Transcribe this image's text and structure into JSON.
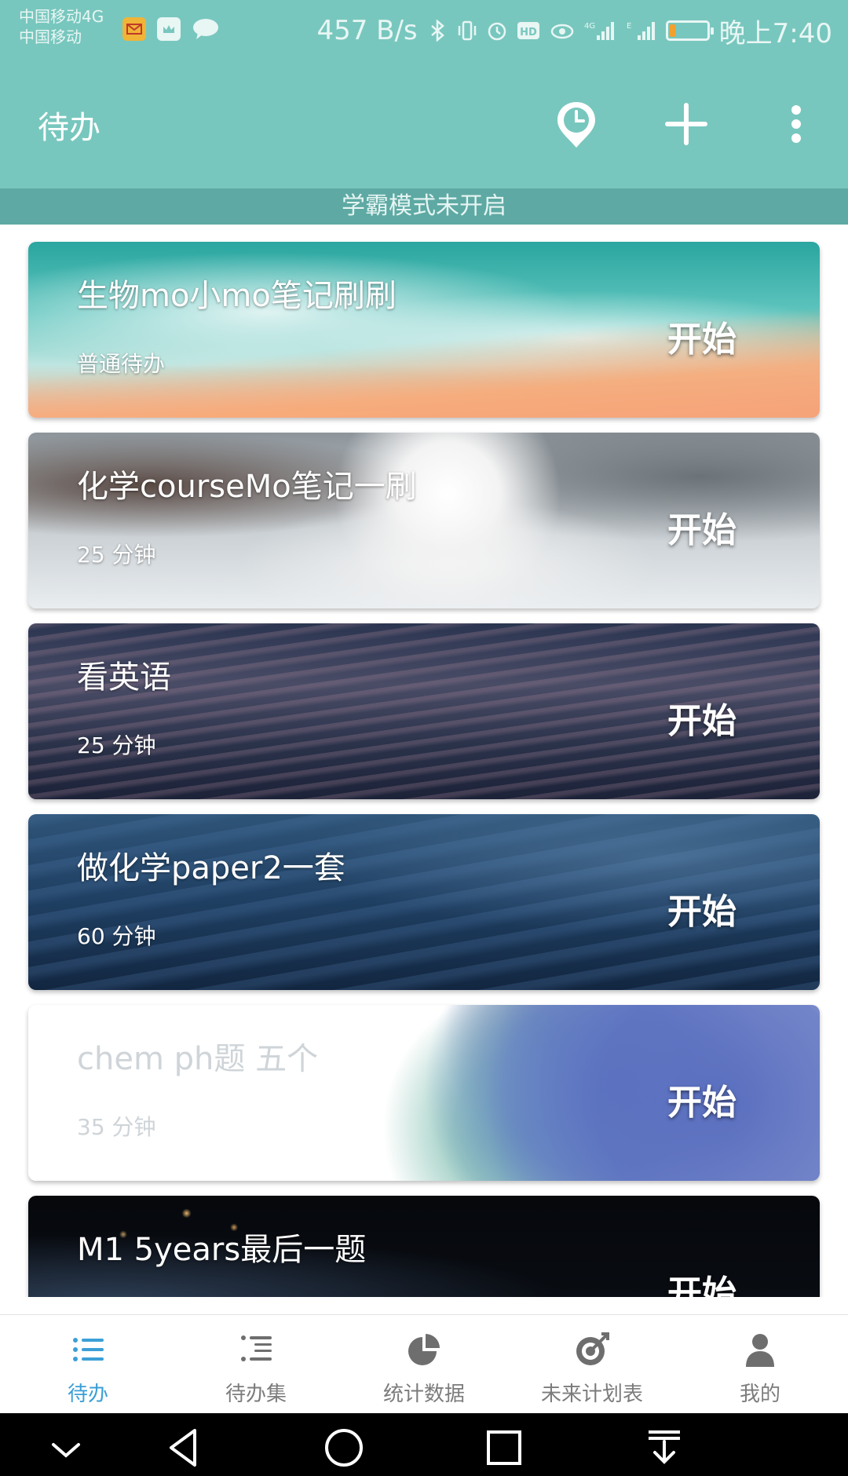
{
  "status_bar": {
    "carrier_line1": "中国移动4G",
    "carrier_line2": "中国移动",
    "net_speed": "457 B/s",
    "time": "晚上7:40",
    "battery_level": 0.15,
    "battery_color": "#f2a02f",
    "icons": [
      "mail-icon",
      "weibo-icon",
      "message-icon",
      "bluetooth-icon",
      "vibrate-icon",
      "alarm-icon",
      "hd-icon",
      "eye-icon",
      "signal-4g-icon",
      "signal-e-icon",
      "battery-icon"
    ]
  },
  "app_bar": {
    "title": "待办",
    "actions": [
      "clock-icon",
      "add-icon",
      "more-vert-icon"
    ],
    "color": "#78c7be"
  },
  "mode_banner": "学霸模式未开启",
  "todos": [
    {
      "title": "生物mo小mo笔记刷刷",
      "subtitle": "普通待办",
      "action": "开始",
      "background": "beach"
    },
    {
      "title": "化学courseMo笔记一刷",
      "subtitle": "25 分钟",
      "action": "开始",
      "background": "dog"
    },
    {
      "title": "看英语",
      "subtitle": "25 分钟",
      "action": "开始",
      "background": "dark-waves"
    },
    {
      "title": "做化学paper2一套",
      "subtitle": "60 分钟",
      "action": "开始",
      "background": "blue-waves"
    },
    {
      "title": "chem ph题 五个",
      "subtitle": "35 分钟",
      "action": "开始",
      "background": "watercolor"
    },
    {
      "title": "M1 5years最后一题",
      "subtitle": "",
      "action": "开始",
      "background": "space"
    }
  ],
  "bottom_nav": {
    "active_color": "#3b9fd6",
    "items": [
      {
        "label": "待办",
        "icon": "list-icon",
        "active": true
      },
      {
        "label": "待办集",
        "icon": "list-set-icon",
        "active": false
      },
      {
        "label": "统计数据",
        "icon": "pie-chart-icon",
        "active": false
      },
      {
        "label": "未来计划表",
        "icon": "target-icon",
        "active": false
      },
      {
        "label": "我的",
        "icon": "person-icon",
        "active": false
      }
    ]
  },
  "system_nav": [
    "collapse-icon",
    "back-icon",
    "home-icon",
    "recents-icon",
    "notification-pull-icon"
  ]
}
